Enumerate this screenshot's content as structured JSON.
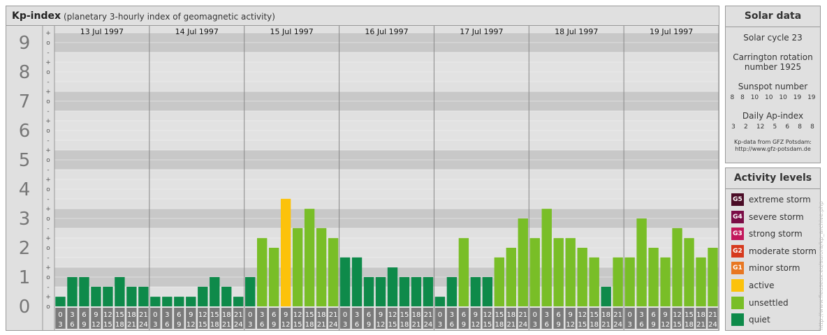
{
  "header": {
    "title": "Kp-index",
    "subtitle": "(planetary 3-hourly index of geomagnetic activity)"
  },
  "chart_data": {
    "type": "bar",
    "y_ticks": [
      "0",
      "1",
      "2",
      "3",
      "4",
      "5",
      "6",
      "7",
      "8",
      "9"
    ],
    "sub_ticks": [
      "o",
      "+",
      "-"
    ],
    "ylim": [
      0,
      9
    ],
    "days": [
      "13 Jul 1997",
      "14 Jul 1997",
      "15 Jul 1997",
      "16 Jul 1997",
      "17 Jul 1997",
      "18 Jul 1997",
      "19 Jul 1997"
    ],
    "interval_start": [
      "0",
      "3",
      "6",
      "9",
      "12",
      "15",
      "18",
      "21"
    ],
    "interval_end": [
      "3",
      "6",
      "9",
      "12",
      "15",
      "18",
      "21",
      "24"
    ],
    "values": [
      0.33,
      1,
      1,
      0.67,
      0.67,
      1,
      0.67,
      0.67,
      0.33,
      0.33,
      0.33,
      0.33,
      0.67,
      1,
      0.67,
      0.33,
      1,
      2.33,
      2,
      3.67,
      2.67,
      3.33,
      2.67,
      2.33,
      1.67,
      1.67,
      1,
      1,
      1.33,
      1,
      1,
      1,
      0.33,
      1,
      2.33,
      1,
      1,
      1.67,
      2,
      3,
      2.33,
      3.33,
      2.33,
      2.33,
      2,
      1.67,
      0.67,
      1.67,
      1.67,
      3,
      2,
      1.67,
      2.67,
      2.33,
      1.67,
      2
    ],
    "levels": [
      "quiet",
      "quiet",
      "quiet",
      "quiet",
      "quiet",
      "quiet",
      "quiet",
      "quiet",
      "quiet",
      "quiet",
      "quiet",
      "quiet",
      "quiet",
      "quiet",
      "quiet",
      "quiet",
      "quiet",
      "unsettled",
      "unsettled",
      "active",
      "unsettled",
      "unsettled",
      "unsettled",
      "unsettled",
      "quiet",
      "quiet",
      "quiet",
      "quiet",
      "quiet",
      "quiet",
      "quiet",
      "quiet",
      "quiet",
      "quiet",
      "unsettled",
      "quiet",
      "quiet",
      "unsettled",
      "unsettled",
      "unsettled",
      "unsettled",
      "unsettled",
      "unsettled",
      "unsettled",
      "unsettled",
      "unsettled",
      "quiet",
      "unsettled",
      "unsettled",
      "unsettled",
      "unsettled",
      "unsettled",
      "unsettled",
      "unsettled",
      "unsettled",
      "unsettled"
    ],
    "level_colors": {
      "quiet": "#0e8a4a",
      "unsettled": "#79be27",
      "active": "#fcc20b"
    },
    "grid": true
  },
  "solar": {
    "title": "Solar data",
    "cycle": "Solar cycle 23",
    "carrington_line1": "Carrington rotation",
    "carrington_line2": "number 1925",
    "sunspot_label": "Sunspot number",
    "sunspot_values": [
      "8",
      "8",
      "10",
      "10",
      "10",
      "19",
      "19"
    ],
    "ap_label": "Daily Ap-index",
    "ap_values": [
      "3",
      "2",
      "12",
      "5",
      "6",
      "8",
      "8"
    ],
    "credit_line1": "Kp-data from GFZ Potsdam:",
    "credit_line2": "http://www.gfz-potsdam.de"
  },
  "activity": {
    "title": "Activity levels",
    "levels": [
      {
        "code": "G5",
        "label": "extreme storm",
        "color": "#4a0c26"
      },
      {
        "code": "G4",
        "label": "severe storm",
        "color": "#7a0d46"
      },
      {
        "code": "G3",
        "label": "strong storm",
        "color": "#c2185b"
      },
      {
        "code": "G2",
        "label": "moderate storm",
        "color": "#d63a1e"
      },
      {
        "code": "G1",
        "label": "minor storm",
        "color": "#e87722"
      },
      {
        "code": "",
        "label": "active",
        "color": "#fcc20b"
      },
      {
        "code": "",
        "label": "unsettled",
        "color": "#79be27"
      },
      {
        "code": "",
        "label": "quiet",
        "color": "#0e8a4a"
      }
    ]
  },
  "watermark": "http://www.fleuseux.eu/aurora/kp_archive.php"
}
